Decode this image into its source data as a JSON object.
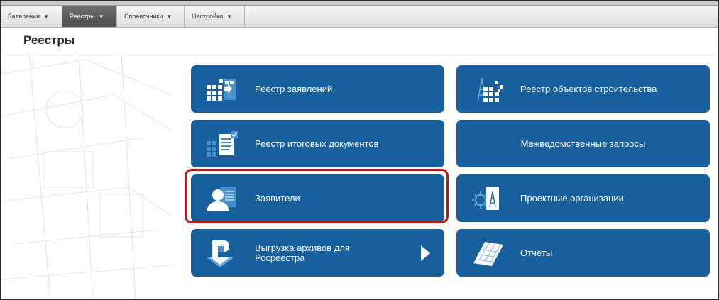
{
  "menu": [
    {
      "label": "Заявления",
      "active": false
    },
    {
      "label": "Реестры",
      "active": true
    },
    {
      "label": "Справочники",
      "active": false
    },
    {
      "label": "Настройки",
      "active": false
    }
  ],
  "menu_arrow": "▼",
  "page_title": "Реестры",
  "tiles": {
    "applications_registry": {
      "label": "Реестр заявлений",
      "icon": "grid-arrow-icon"
    },
    "construction_registry": {
      "label": "Реестр объектов строительства",
      "icon": "tower-grid-icon"
    },
    "final_docs_registry": {
      "label": "Реестр итоговых документов",
      "icon": "grid-document-icon"
    },
    "interagency_requests": {
      "label": "Межведомственные запросы"
    },
    "applicants": {
      "label": "Заявители",
      "icon": "person-card-icon"
    },
    "design_organizations": {
      "label": "Проектные организации",
      "icon": "gear-document-icon"
    },
    "rosreestr_export": {
      "label_line1": "Выгрузка архивов для",
      "label_line2": "Росреестра",
      "icon": "rosreestr-logo-icon"
    },
    "reports": {
      "label": "Отчёты",
      "icon": "spreadsheet-icon"
    }
  },
  "colors": {
    "tile": "#17609d",
    "highlight": "#b71c1c",
    "active_menu": "#5c5c5c"
  }
}
